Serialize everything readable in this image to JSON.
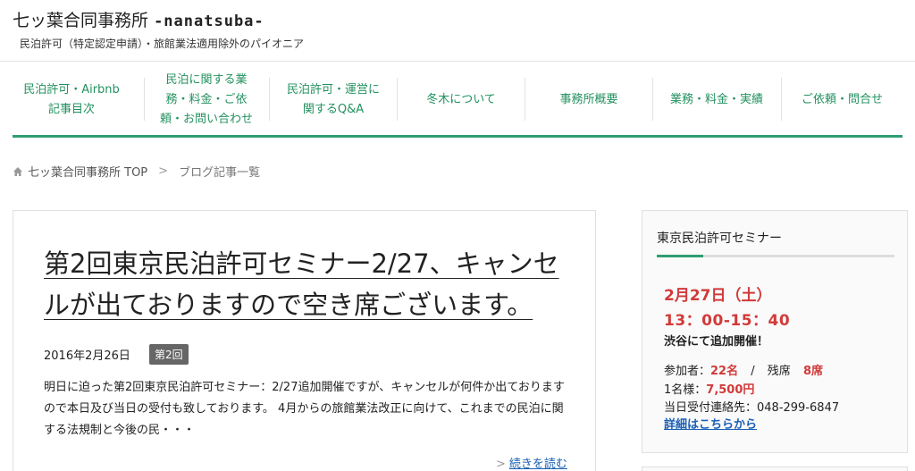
{
  "header": {
    "title": "七ッ葉合同事務所",
    "title_latin": "-nanatsuba-",
    "tagline": "民泊許可（特定認定申請）・旅館業法適用除外のパイオニア"
  },
  "nav": {
    "items": [
      {
        "label": "民泊許可・Airbnb\n記事目次"
      },
      {
        "label": "民泊に関する業\n務・料金・ご依\n頼・お問い合わせ"
      },
      {
        "label": "民泊許可・運営に\n関するQ&A"
      },
      {
        "label": "冬木について"
      },
      {
        "label": "事務所概要"
      },
      {
        "label": "業務・料金・実績"
      },
      {
        "label": "ご依頼・問合せ"
      }
    ]
  },
  "breadcrumb": {
    "home": "七ッ葉合同事務所 TOP",
    "separator": ">",
    "current": "ブログ記事一覧"
  },
  "post": {
    "title": "第2回東京民泊許可セミナー2/27、キャンセルが出ておりますので空き席ございます。",
    "date": "2016年2月26日",
    "tag": "第2回",
    "excerpt": "明日に迫った第2回東京民泊許可セミナー：2/27追加開催ですが、キャンセルが何件か出ておりますので本日及び当日の受付も致しております。 4月からの旅館業法改正に向けて、これまでの民泊に関する法規制と今後の民・・・",
    "read_more": "続きを読む",
    "read_more_chevron": ">"
  },
  "widget": {
    "title": "東京民泊許可セミナー",
    "date": "2月27日（土）",
    "time": "13：00-15：40",
    "location": "渋谷にて追加開催！",
    "participants_label": "参加者：",
    "participants_value": "22名",
    "remaining_sep": "/",
    "remaining_label": "残席",
    "remaining_value": "8席",
    "price_label": "1名様：",
    "price_value": "7,500円",
    "contact_label": "当日受付連絡先：",
    "contact_value": "048-299-6847",
    "details_link": "詳細はこちらから"
  },
  "colors": {
    "accent_green": "#2e9e72",
    "nav_text": "#23915f",
    "highlight_red": "#d23a3a",
    "link_blue": "#1a5fb4"
  }
}
